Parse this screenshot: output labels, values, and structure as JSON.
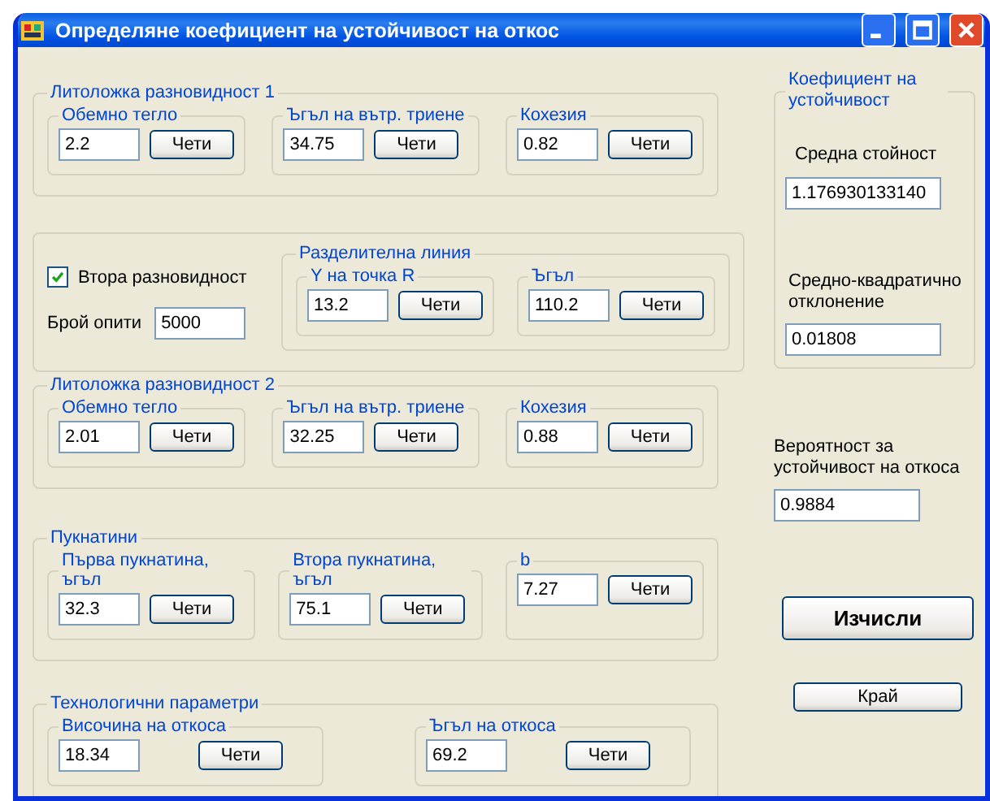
{
  "window": {
    "title": "Определяне коефициент на устойчивост на откос"
  },
  "sections": [
    {
      "kind": "params",
      "title": "Литоложка разновидност 1",
      "params": [
        {
          "label": "Обемно тегло",
          "value": "2.2",
          "button": "Чети"
        },
        {
          "label": "Ъгъл на вътр. триене",
          "value": "34.75",
          "button": "Чети"
        },
        {
          "label": "Кохезия",
          "value": "0.82",
          "button": "Чети"
        }
      ]
    },
    {
      "kind": "options",
      "checkbox": {
        "label": "Втора разновидност",
        "checked": true
      },
      "trials": {
        "label": "Брой опити",
        "value": "5000"
      },
      "dividing_line": {
        "title": "Разделителна линия",
        "params": [
          {
            "label": "Y на точка R",
            "value": "13.2",
            "button": "Чети"
          },
          {
            "label": "Ъгъл",
            "value": "110.2",
            "button": "Чети"
          }
        ]
      }
    },
    {
      "kind": "params",
      "title": "Литоложка разновидност 2",
      "params": [
        {
          "label": "Обемно тегло",
          "value": "2.01",
          "button": "Чети"
        },
        {
          "label": "Ъгъл на вътр. триене",
          "value": "32.25",
          "button": "Чети"
        },
        {
          "label": "Кохезия",
          "value": "0.88",
          "button": "Чети"
        }
      ]
    },
    {
      "kind": "params",
      "title": "Пукнатини",
      "params": [
        {
          "label": "Първа пукнатина, ъгъл",
          "value": "32.3",
          "button": "Чети"
        },
        {
          "label": "Втора  пукнатина, ъгъл",
          "value": "75.1",
          "button": "Чети"
        },
        {
          "label": "b",
          "value": "7.27",
          "button": "Чети"
        }
      ]
    },
    {
      "kind": "params",
      "title": "Технологични параметри",
      "params": [
        {
          "label": "Височина на откоса",
          "value": "18.34",
          "button": "Чети"
        },
        {
          "label": "Ъгъл на откоса",
          "value": "69.2",
          "button": "Чети"
        }
      ]
    }
  ],
  "coefficient": {
    "title": "Коефициент на устойчивост",
    "mean_label": "Средна стойност",
    "mean_value": "1.176930133140",
    "std_label": "Средно-квадратично отклонение",
    "std_value": "0.01808"
  },
  "probability": {
    "label": "Вероятност за устойчивост на откоса",
    "value": "0.9884"
  },
  "buttons": [
    {
      "label": "Изчисли",
      "kind": "primary"
    },
    {
      "label": "Край",
      "kind": "normal"
    }
  ]
}
